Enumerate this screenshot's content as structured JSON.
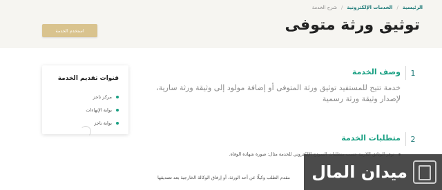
{
  "breadcrumb": {
    "home": "الرئيسية",
    "services": "الخدمات الإلكترونية",
    "current": "شرح الخدمة"
  },
  "page_title": "توثيق ورثة متوفى",
  "use_service_label": "استخدم الخدمة",
  "channels": {
    "title": "قنوات تقديم الخدمة",
    "items": [
      "مركز ناجز",
      "بوابة الإنهاءات",
      "بوابة ناجز"
    ]
  },
  "sections": [
    {
      "number": "1",
      "title": "وصف الخدمة",
      "body": "خدمة تتيح للمستفيد توثيق ورثة المتوفى أو إضافة مولود إلى وثيقة ورثة سارية، لإصدار وثيقة ورثة رسمية"
    },
    {
      "number": "2",
      "title": "متطلبات الخدمة",
      "items": [
        "توفر الوثائق اللازمة حسب متطلبات النموذج الإلكتروني للخدمة مثال: صورة شهادة الوفاة.",
        "مقدم الطلب وكيلًا عن أحد الورثة، أو إرفاق الوكالة الخارجية بعد تصديقها"
      ]
    }
  ],
  "watermark": "ميدان المال",
  "colors": {
    "accent": "#1aa083",
    "brand_dark": "#1f7a78",
    "button": "#d9c38e",
    "header_bg": "#f6f5f1"
  }
}
